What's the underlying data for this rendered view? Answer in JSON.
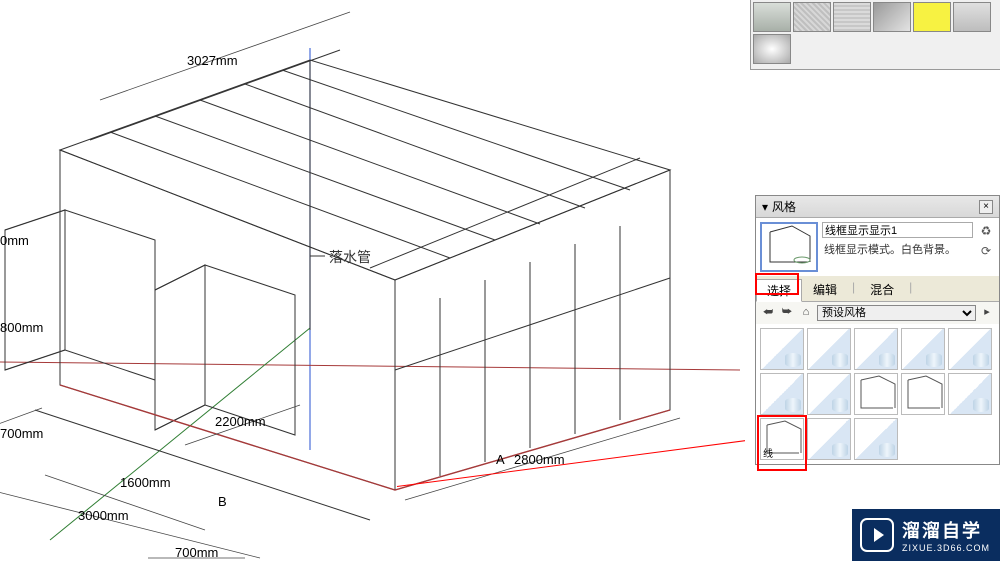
{
  "viewport": {
    "dimensions": {
      "d_3027": "3027mm",
      "d_0_top": "0mm",
      "d_800": "800mm",
      "d_700a": "700mm",
      "d_1600": "1600mm",
      "d_3000": "3000mm",
      "d_700b": "700mm",
      "d_2200": "2200mm",
      "d_2800": "2800mm",
      "section_A": "A",
      "section_B": "B"
    },
    "annotation_downpipe": "落水管"
  },
  "materials": {
    "swatches": [
      {
        "name": "mat-gray1",
        "bg": "linear-gradient(#d9ded9,#a8b0a8)"
      },
      {
        "name": "mat-noise1",
        "bg": "repeating-linear-gradient(45deg,#bfbfbf 0 2px,#d7d7d7 2px 4px)"
      },
      {
        "name": "mat-noise2",
        "bg": "repeating-linear-gradient(0deg,#c7c7c7 0 2px,#dadada 2px 4px)"
      },
      {
        "name": "mat-gray-diag",
        "bg": "linear-gradient(135deg,#9a9a9a,#e3e3e3)"
      },
      {
        "name": "mat-yellow",
        "bg": "#f7f242"
      },
      {
        "name": "mat-gray-solid",
        "bg": "linear-gradient(#e0e0e0,#bdbdbd)"
      },
      {
        "name": "mat-silver",
        "bg": "radial-gradient(#fff,#a9a9a9)"
      }
    ]
  },
  "styles_panel": {
    "header": "风格",
    "style_name": "线框显示显示1",
    "style_desc": "线框显示模式。白色背景。",
    "tabs": [
      "选择",
      "编辑",
      "混合"
    ],
    "active_tab": 0,
    "dropdown_label": "预设风格",
    "thumbs": [
      {
        "name": "style-shaded-1",
        "wire": false
      },
      {
        "name": "style-shaded-2",
        "wire": false
      },
      {
        "name": "style-shaded-3",
        "wire": false
      },
      {
        "name": "style-shaded-4",
        "wire": false
      },
      {
        "name": "style-shaded-5",
        "wire": false
      },
      {
        "name": "style-glass-1",
        "wire": false
      },
      {
        "name": "style-glass-2",
        "wire": false
      },
      {
        "name": "style-hidden-1",
        "wire": true
      },
      {
        "name": "style-hidden-2",
        "wire": true
      },
      {
        "name": "style-xray",
        "wire": false
      },
      {
        "name": "style-wireframe",
        "wire": true,
        "label": "线"
      },
      {
        "name": "style-sketch-1",
        "wire": false
      },
      {
        "name": "style-sketch-2",
        "wire": false
      }
    ],
    "highlighted_thumb": 10
  },
  "watermark": {
    "title": "溜溜自学",
    "url": "ZIXUE.3D66.COM"
  }
}
